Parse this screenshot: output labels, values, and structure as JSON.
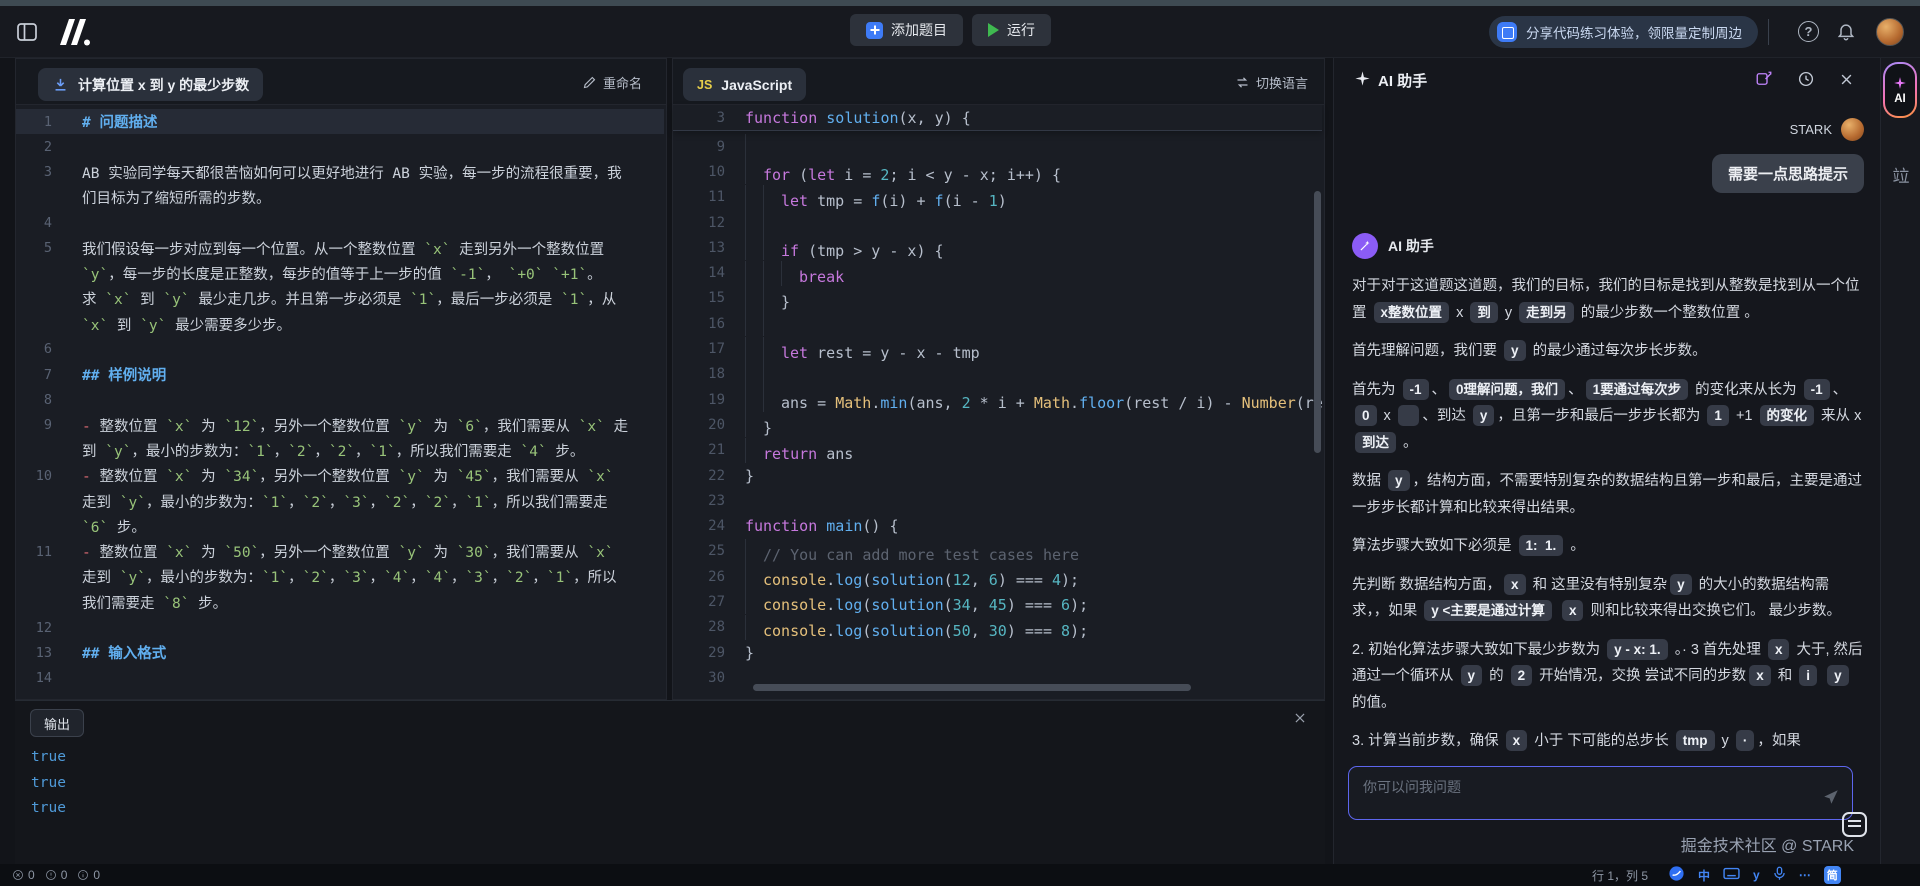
{
  "topbar": {
    "add_label": "添加题目",
    "run_label": "运行",
    "promo_text": "分享代码练习体验，领限量定制周边",
    "help_glyph": "?"
  },
  "problem": {
    "title": "计算位置 x 到 y 的最少步数",
    "rename_label": "重命名",
    "rows": [
      {
        "n": "1",
        "h": 1,
        "hl": 1,
        "t": "# 问题描述"
      },
      {
        "n": "2",
        "t": ""
      },
      {
        "n": "3",
        "t": "AB 实验同学每天都很苦恼如何可以更好地进行 AB 实验，每一步的流程很重要，我"
      },
      {
        "n": "",
        "t": "们目标为了缩短所需的步数。"
      },
      {
        "n": "4",
        "t": ""
      },
      {
        "n": "5",
        "t": "我们假设每一步对应到每一个位置。从一个整数位置 `x` 走到另外一个整数位置"
      },
      {
        "n": "",
        "t": "`y`，每一步的长度是正整数，每步的值等于上一步的值 `-1`， `+0` `+1`。"
      },
      {
        "n": "",
        "t": "求 `x` 到 `y` 最少走几步。并且第一步必须是 `1`，最后一步必须是 `1`，从"
      },
      {
        "n": "",
        "t": "`x` 到 `y` 最少需要多少步。"
      },
      {
        "n": "6",
        "t": ""
      },
      {
        "n": "7",
        "h": 1,
        "t": "## 样例说明"
      },
      {
        "n": "8",
        "t": ""
      },
      {
        "n": "9",
        "t": "- 整数位置 `x` 为 `12`，另外一个整数位置 `y` 为 `6`，我们需要从 `x` 走"
      },
      {
        "n": "",
        "t": "到 `y`，最小的步数为：`1`，`2`，`2`，`1`，所以我们需要走 `4` 步。"
      },
      {
        "n": "10",
        "t": "- 整数位置 `x` 为 `34`，另外一个整数位置 `y` 为 `45`，我们需要从 `x`"
      },
      {
        "n": "",
        "t": "走到 `y`，最小的步数为：`1`，`2`，`3`，`2`，`2`，`1`，所以我们需要走"
      },
      {
        "n": "",
        "t": "`6` 步。"
      },
      {
        "n": "11",
        "t": "- 整数位置 `x` 为 `50`，另外一个整数位置 `y` 为 `30`，我们需要从 `x`"
      },
      {
        "n": "",
        "t": "走到 `y`，最小的步数为：`1`，`2`，`3`，`4`，`4`，`3`，`2`，`1`，所以"
      },
      {
        "n": "",
        "t": "我们需要走 `8` 步。"
      },
      {
        "n": "12",
        "t": ""
      },
      {
        "n": "13",
        "h": 1,
        "t": "## 输入格式"
      },
      {
        "n": "14",
        "t": ""
      }
    ]
  },
  "editor": {
    "tab_js": "JS",
    "tab_label": "JavaScript",
    "switch_label": "切换语言",
    "sticky": {
      "n": "3",
      "ind": 0,
      "seg": [
        [
          "k",
          "function"
        ],
        [
          "d",
          " "
        ],
        [
          "fn",
          "solution"
        ],
        [
          "d",
          "(x, y) {"
        ]
      ]
    },
    "rows": [
      {
        "n": "9",
        "ind": 1,
        "seg": []
      },
      {
        "n": "10",
        "ind": 1,
        "seg": [
          [
            "k",
            "for"
          ],
          [
            "d",
            " ("
          ],
          [
            "k",
            "let"
          ],
          [
            "d",
            " i = "
          ],
          [
            "n",
            "2"
          ],
          [
            "d",
            "; i < y - x; i++) {"
          ]
        ]
      },
      {
        "n": "11",
        "ind": 2,
        "seg": [
          [
            "k",
            "let"
          ],
          [
            "d",
            " tmp = "
          ],
          [
            "fn",
            "f"
          ],
          [
            "d",
            "(i) + "
          ],
          [
            "fn",
            "f"
          ],
          [
            "d",
            "(i - "
          ],
          [
            "n",
            "1"
          ],
          [
            "d",
            ")"
          ]
        ]
      },
      {
        "n": "12",
        "ind": 2,
        "seg": []
      },
      {
        "n": "13",
        "ind": 2,
        "seg": [
          [
            "k",
            "if"
          ],
          [
            "d",
            " (tmp > y - x) {"
          ]
        ]
      },
      {
        "n": "14",
        "ind": 3,
        "seg": [
          [
            "k",
            "break"
          ]
        ]
      },
      {
        "n": "15",
        "ind": 2,
        "seg": [
          [
            "d",
            "}"
          ]
        ]
      },
      {
        "n": "16",
        "ind": 2,
        "seg": []
      },
      {
        "n": "17",
        "ind": 2,
        "seg": [
          [
            "k",
            "let"
          ],
          [
            "d",
            " rest = y - x - tmp"
          ]
        ]
      },
      {
        "n": "18",
        "ind": 2,
        "seg": []
      },
      {
        "n": "19",
        "ind": 2,
        "seg": [
          [
            "d",
            "ans = "
          ],
          [
            "b",
            "Math"
          ],
          [
            "d",
            "."
          ],
          [
            "fn",
            "min"
          ],
          [
            "d",
            "(ans, "
          ],
          [
            "n",
            "2"
          ],
          [
            "d",
            " * i + "
          ],
          [
            "b",
            "Math"
          ],
          [
            "d",
            "."
          ],
          [
            "fn",
            "floor"
          ],
          [
            "d",
            "(rest / i) - "
          ],
          [
            "b",
            "Number"
          ],
          [
            "d",
            "(res"
          ]
        ]
      },
      {
        "n": "20",
        "ind": 1,
        "seg": [
          [
            "d",
            "}"
          ]
        ]
      },
      {
        "n": "21",
        "ind": 1,
        "seg": [
          [
            "k",
            "return"
          ],
          [
            "d",
            " ans"
          ]
        ]
      },
      {
        "n": "22",
        "ind": 0,
        "seg": [
          [
            "d",
            "}"
          ]
        ]
      },
      {
        "n": "23",
        "ind": 0,
        "seg": []
      },
      {
        "n": "24",
        "ind": 0,
        "seg": [
          [
            "k",
            "function"
          ],
          [
            "d",
            " "
          ],
          [
            "fn",
            "main"
          ],
          [
            "d",
            "() {"
          ]
        ]
      },
      {
        "n": "25",
        "ind": 1,
        "seg": [
          [
            "cm",
            "// You can add more test cases here"
          ]
        ]
      },
      {
        "n": "26",
        "ind": 1,
        "seg": [
          [
            "b",
            "console"
          ],
          [
            "d",
            "."
          ],
          [
            "fn",
            "log"
          ],
          [
            "d",
            "("
          ],
          [
            "fn",
            "solution"
          ],
          [
            "d",
            "("
          ],
          [
            "n",
            "12"
          ],
          [
            "d",
            ", "
          ],
          [
            "n",
            "6"
          ],
          [
            "d",
            ") === "
          ],
          [
            "n",
            "4"
          ],
          [
            "d",
            ");"
          ]
        ]
      },
      {
        "n": "27",
        "ind": 1,
        "seg": [
          [
            "b",
            "console"
          ],
          [
            "d",
            "."
          ],
          [
            "fn",
            "log"
          ],
          [
            "d",
            "("
          ],
          [
            "fn",
            "solution"
          ],
          [
            "d",
            "("
          ],
          [
            "n",
            "34"
          ],
          [
            "d",
            ", "
          ],
          [
            "n",
            "45"
          ],
          [
            "d",
            ") === "
          ],
          [
            "n",
            "6"
          ],
          [
            "d",
            ");"
          ]
        ]
      },
      {
        "n": "28",
        "ind": 1,
        "seg": [
          [
            "b",
            "console"
          ],
          [
            "d",
            "."
          ],
          [
            "fn",
            "log"
          ],
          [
            "d",
            "("
          ],
          [
            "fn",
            "solution"
          ],
          [
            "d",
            "("
          ],
          [
            "n",
            "50"
          ],
          [
            "d",
            ", "
          ],
          [
            "n",
            "30"
          ],
          [
            "d",
            ") === "
          ],
          [
            "n",
            "8"
          ],
          [
            "d",
            ");"
          ]
        ]
      },
      {
        "n": "29",
        "ind": 0,
        "seg": [
          [
            "d",
            "}"
          ]
        ]
      },
      {
        "n": "30",
        "ind": 0,
        "seg": []
      }
    ]
  },
  "ai": {
    "header_title": "AI 助手",
    "user_name": "STARK",
    "user_message": "需要一点思路提示",
    "assistant_name": "AI 助手",
    "input_placeholder": "你可以问我问题",
    "paragraphs": [
      {
        "seg": [
          [
            "t",
            "对于对于这道题这道题，我们的目标，我们的目标是找到从整数是找到从一个位置 "
          ],
          [
            "chip",
            "x整数位置"
          ],
          [
            "t",
            " x "
          ],
          [
            "chip",
            "到"
          ],
          [
            "t",
            " y "
          ],
          [
            "chip",
            "走到另"
          ],
          [
            "t",
            " 的最少步数一个整数位置 。"
          ]
        ]
      },
      {
        "seg": [
          [
            "t",
            "首先理解问题，我们要 "
          ],
          [
            "chip",
            "y"
          ],
          [
            "t",
            " 的最少通过每次步长步数。"
          ]
        ]
      },
      {
        "seg": [
          [
            "t",
            "首先为 "
          ],
          [
            "chip",
            "-1"
          ],
          [
            "t",
            "、"
          ],
          [
            "chip",
            "0理解问题，我们"
          ],
          [
            "t",
            "、"
          ],
          [
            "chip",
            "1要通过每次步"
          ],
          [
            "t",
            " 的变化来从长为 "
          ],
          [
            "chip",
            "-1"
          ],
          [
            "t",
            "、"
          ],
          [
            "chip",
            "0"
          ],
          [
            "t",
            " x "
          ],
          [
            "chip",
            "  "
          ],
          [
            "t",
            "、到达 "
          ],
          [
            "chip",
            "y"
          ],
          [
            "t",
            "，且第一步和最后一步步长都为 "
          ],
          [
            "chip",
            "1"
          ],
          [
            "t",
            " +1 "
          ],
          [
            "chip",
            "的变化"
          ],
          [
            "t",
            " 来从 x "
          ],
          [
            "chip",
            "到达"
          ],
          [
            "t",
            " 。"
          ]
        ]
      },
      {
        "seg": [
          [
            "t",
            "数据 "
          ],
          [
            "chip",
            "y"
          ],
          [
            "t",
            "，结构方面，不需要特别复杂的数据结构且第一步和最后，主要是通过一步步长都计算和比较来得出结果。"
          ]
        ]
      },
      {
        "seg": [
          [
            "t",
            "算法步骤大致如下必须是 "
          ],
          [
            "chip",
            "1:  1."
          ],
          [
            "t",
            " 。"
          ]
        ]
      },
      {
        "seg": [
          [
            "t",
            "先判断 数据结构方面，"
          ],
          [
            "chip",
            "x"
          ],
          [
            "t",
            " 和 这里没有特别复杂"
          ],
          [
            "chip",
            "y"
          ],
          [
            "t",
            " 的大小的数据结构需求，，如果 "
          ],
          [
            "chip",
            "y <主要是通过计算"
          ],
          [
            "t",
            " "
          ],
          [
            "chip",
            "x"
          ],
          [
            "t",
            " 则和比较来得出交换它们。 最少步数。"
          ]
        ]
      },
      {
        "seg": [
          [
            "t",
            "2. 初始化算法步骤大致如下最少步数为 "
          ],
          [
            "chip",
            "y - x: 1."
          ],
          [
            "t",
            " 。· 3 首先处理 "
          ],
          [
            "chip",
            "x"
          ],
          [
            "t",
            " 大于, 然后通过一个循环从 "
          ],
          [
            "chip",
            "y"
          ],
          [
            "t",
            " 的 "
          ],
          [
            "chip",
            "2"
          ],
          [
            "t",
            " 开始情况，交换 尝试不同的步数"
          ],
          [
            "chip",
            "x"
          ],
          [
            "t",
            " 和 "
          ],
          [
            "chip",
            "i"
          ],
          [
            "t",
            " "
          ],
          [
            "chip",
            "y"
          ],
          [
            "t",
            " 的值。"
          ]
        ]
      },
      {
        "seg": [
          [
            "t",
            "3. 计算当前步数，确保 "
          ],
          [
            "chip",
            "x"
          ],
          [
            "t",
            " 小于 下可能的总步长 "
          ],
          [
            "chip",
            "tmp"
          ],
          [
            "t",
            " y "
          ],
          [
            "chip",
            "·"
          ],
          [
            "t",
            "，如果"
          ]
        ]
      }
    ]
  },
  "rail": {
    "ai_label": "AI",
    "extra_glyph": "竝"
  },
  "output": {
    "tab": "输出",
    "lines": [
      "true",
      "true",
      "true"
    ]
  },
  "statusbar": {
    "errors": "0",
    "warnings": "0",
    "infos": "0",
    "cursor": "行 1，列 5",
    "ime_lang": "中",
    "ime_hand": "y",
    "ime_more": "⋯",
    "ime_jian": "简",
    "watermark": "掘金技术社区 @ STARK"
  }
}
